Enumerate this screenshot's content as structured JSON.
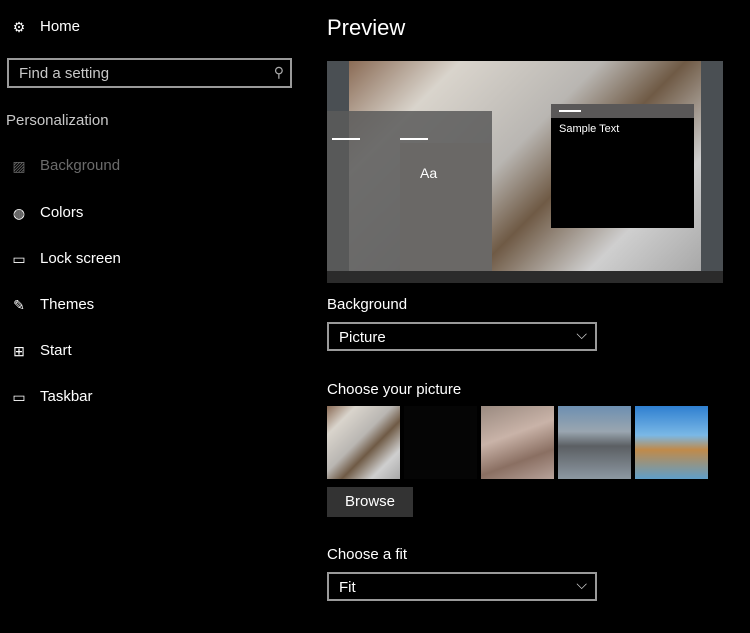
{
  "sidebar": {
    "home": "Home",
    "search_placeholder": "Find a setting",
    "section": "Personalization",
    "items": [
      {
        "label": "Background",
        "icon": "picture-icon"
      },
      {
        "label": "Colors",
        "icon": "palette-icon"
      },
      {
        "label": "Lock screen",
        "icon": "lock-screen-icon"
      },
      {
        "label": "Themes",
        "icon": "themes-icon"
      },
      {
        "label": "Start",
        "icon": "start-icon"
      },
      {
        "label": "Taskbar",
        "icon": "taskbar-icon"
      }
    ]
  },
  "main": {
    "title": "Preview",
    "preview": {
      "tile_text": "Aa",
      "sample_text": "Sample Text"
    },
    "background_label": "Background",
    "background_value": "Picture",
    "choose_picture_label": "Choose your picture",
    "browse": "Browse",
    "fit_label": "Choose a fit",
    "fit_value": "Fit"
  },
  "colors": {
    "selected_nav": "#6b6b6b",
    "button": "#333333",
    "border": "#9a9a9a"
  }
}
